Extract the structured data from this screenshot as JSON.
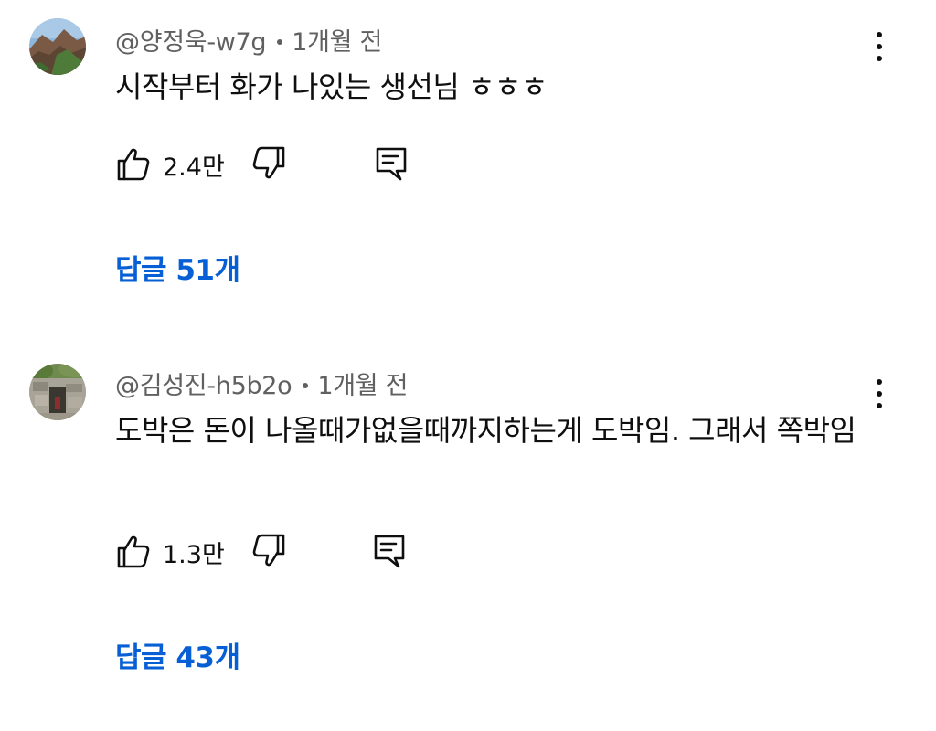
{
  "comments": [
    {
      "author": "@양정욱-w7g",
      "time": "1개월 전",
      "text": "시작부터 화가 나있는 생선님 ㅎㅎㅎ",
      "likes": "2.4만",
      "replies": "답글 51개",
      "avatar_icon": "mountain-landscape-avatar"
    },
    {
      "author": "@김성진-h5b2o",
      "time": "1개월 전",
      "text": "도박은 돈이 나올때가없을때까지하는게 도박임. 그래서 쪽박임",
      "likes": "1.3만",
      "replies": "답글 43개",
      "avatar_icon": "stone-ruins-avatar"
    }
  ],
  "icons": {
    "like": "thumbs-up-icon",
    "dislike": "thumbs-down-icon",
    "reply": "reply-comment-icon",
    "menu": "more-vertical-icon"
  },
  "colors": {
    "replies_link": "#065fd4",
    "meta_text": "#606060",
    "body_text": "#0f0f0f"
  }
}
